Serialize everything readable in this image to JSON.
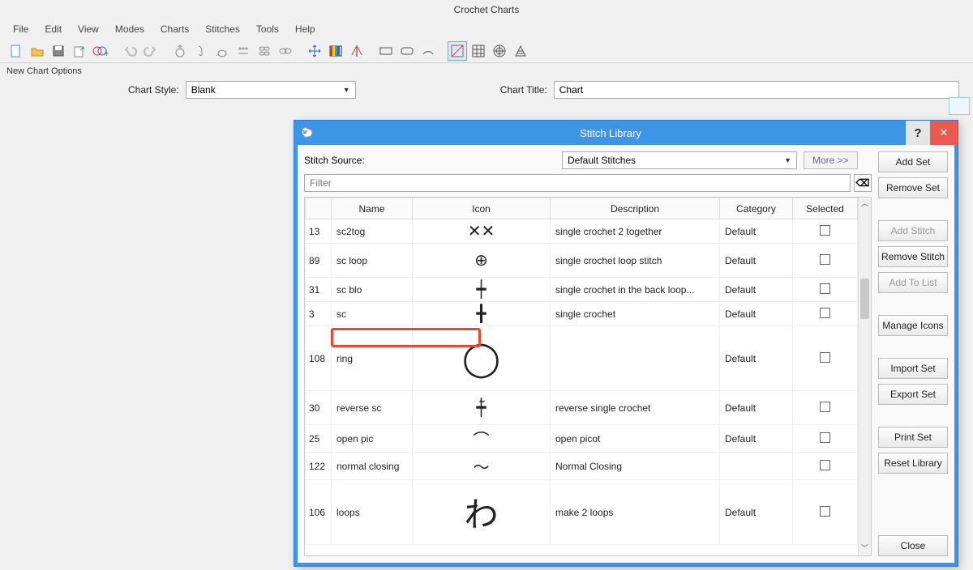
{
  "app": {
    "title": "Crochet Charts"
  },
  "menu": [
    "File",
    "Edit",
    "View",
    "Modes",
    "Charts",
    "Stitches",
    "Tools",
    "Help"
  ],
  "options": {
    "panel_label": "New Chart Options",
    "style_label": "Chart Style:",
    "style_value": "Blank",
    "title_label": "Chart Title:",
    "title_value": "Chart"
  },
  "dialog": {
    "title": "Stitch Library",
    "source_label": "Stitch Source:",
    "source_value": "Default Stitches",
    "more_label": "More >>",
    "filter_placeholder": "Filter",
    "columns": [
      "",
      "Name",
      "Icon",
      "Description",
      "Category",
      "Selected"
    ],
    "rows": [
      {
        "num": "13",
        "name": "sc2tog",
        "desc": "single crochet 2 together",
        "cat": "Default",
        "icon": "✕✕",
        "h": "norm"
      },
      {
        "num": "89",
        "name": "sc loop",
        "desc": "single crochet loop stitch",
        "cat": "Default",
        "icon": "⊕",
        "h": "med"
      },
      {
        "num": "31",
        "name": "sc blo",
        "desc": "single crochet in the back loop...",
        "cat": "Default",
        "icon": "┿",
        "h": "norm"
      },
      {
        "num": "3",
        "name": "sc",
        "desc": "single crochet",
        "cat": "Default",
        "icon": "╋",
        "h": "norm"
      },
      {
        "num": "108",
        "name": "ring",
        "desc": "",
        "cat": "Default",
        "icon": "◯",
        "h": "tall"
      },
      {
        "num": "30",
        "name": "reverse sc",
        "desc": "reverse single crochet",
        "cat": "Default",
        "icon": "┿̃",
        "h": "med"
      },
      {
        "num": "25",
        "name": "open pic",
        "desc": "open picot",
        "cat": "Default",
        "icon": "⌒",
        "h": "norm"
      },
      {
        "num": "122",
        "name": "normal closing",
        "desc": "Normal Closing",
        "cat": "",
        "icon": "〜",
        "h": "norm"
      },
      {
        "num": "106",
        "name": "loops",
        "desc": "make 2 loops",
        "cat": "Default",
        "icon": "わ",
        "h": "tall"
      }
    ],
    "buttons": {
      "add_set": "Add Set",
      "remove_set": "Remove Set",
      "add_stitch": "Add Stitch",
      "remove_stitch": "Remove Stitch",
      "add_to_list": "Add To List",
      "manage_icons": "Manage Icons",
      "import_set": "Import Set",
      "export_set": "Export Set",
      "print_set": "Print Set",
      "reset_library": "Reset Library",
      "close": "Close"
    }
  }
}
